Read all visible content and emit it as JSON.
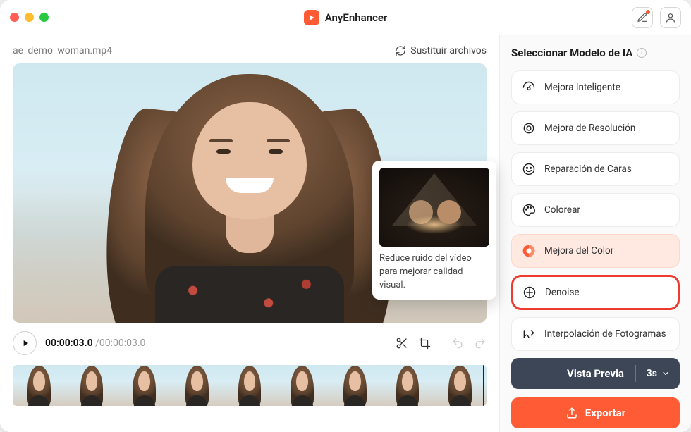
{
  "app": {
    "name": "AnyEnhancer"
  },
  "file": {
    "name": "ae_demo_woman.mp4",
    "replace_label": "Sustituir archivos"
  },
  "tooltip": {
    "text": "Reduce ruido del vídeo para mejorar calidad visual."
  },
  "playback": {
    "current": "00:00:03.0",
    "duration": "00:00:03.0"
  },
  "panel": {
    "title": "Seleccionar Modelo de IA",
    "models": [
      {
        "label": "Mejora Inteligente"
      },
      {
        "label": "Mejora de Resolución"
      },
      {
        "label": "Reparación de Caras"
      },
      {
        "label": "Colorear"
      },
      {
        "label": "Mejora del Color"
      },
      {
        "label": "Denoise"
      },
      {
        "label": "Interpolación de Fotogramas"
      }
    ],
    "preview": {
      "label": "Vista Previa",
      "duration": "3s"
    },
    "export": {
      "label": "Exportar"
    }
  },
  "colors": {
    "accent": "#ff5b35",
    "highlight": "#ef3b2f",
    "dark": "#3c4657"
  }
}
